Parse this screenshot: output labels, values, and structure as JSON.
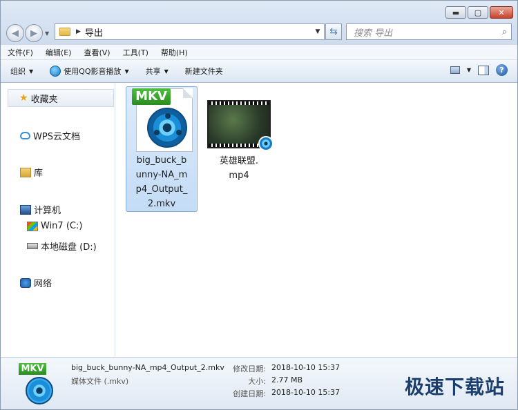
{
  "window": {
    "controls": {
      "minimize": "▬",
      "maximize": "▢",
      "close": "✕"
    }
  },
  "address": {
    "folder": "导出",
    "placeholder": "搜索 导出"
  },
  "menubar": [
    "文件(F)",
    "编辑(E)",
    "查看(V)",
    "工具(T)",
    "帮助(H)"
  ],
  "commands": {
    "organize": "组织",
    "play_qq": "使用QQ影音播放",
    "share": "共享",
    "new_folder": "新建文件夹"
  },
  "sidebar": {
    "favorites": "收藏夹",
    "wps": "WPS云文档",
    "library": "库",
    "computer": "计算机",
    "drive_c": "Win7 (C:)",
    "drive_d": "本地磁盘 (D:)",
    "network": "网络"
  },
  "files": [
    {
      "name_lines": [
        "big_buck_b",
        "unny-NA_m",
        "p4_Output_",
        "2.mkv"
      ],
      "type_badge": "MKV",
      "selected": true
    },
    {
      "name_lines": [
        "英雄联盟.",
        "mp4"
      ],
      "type_badge": "",
      "selected": false
    }
  ],
  "details": {
    "filename": "big_buck_bunny-NA_mp4_Output_2.mkv",
    "filetype": "媒体文件 (.mkv)",
    "badge": "MKV",
    "modified_label": "修改日期:",
    "modified_value": "2018-10-10 15:37",
    "size_label": "大小:",
    "size_value": "2.77 MB",
    "created_label": "创建日期:",
    "created_value": "2018-10-10 15:37"
  },
  "watermark": "极速下载站",
  "colors": {
    "accent": "#1b3e6f",
    "selection": "#c4dcf6",
    "mkv_green": "#2a8d1f"
  }
}
